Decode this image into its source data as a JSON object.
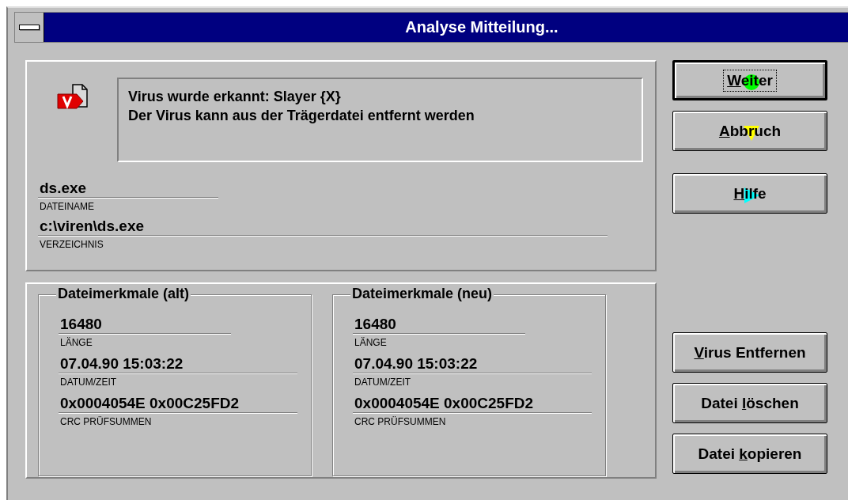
{
  "window": {
    "title": "Analyse Mitteilung..."
  },
  "message": {
    "lines": [
      "Virus wurde erkannt: Slayer {X}",
      "Der Virus kann aus der Trägerdatei entfernt werden"
    ]
  },
  "file_fields": [
    {
      "kind": "short",
      "value": "ds.exe",
      "label": "DATEINAME"
    },
    {
      "kind": "long",
      "value": "c:\\viren\\ds.exe",
      "label": "VERZEICHNIS"
    }
  ],
  "groups": [
    {
      "title": "Dateimerkmale (alt)",
      "fields": [
        {
          "kind": "short",
          "value": "16480",
          "label": "LÄNGE"
        },
        {
          "kind": "long",
          "value": "07.04.90 15:03:22",
          "label": "DATUM/ZEIT"
        },
        {
          "kind": "long",
          "value": "0x0004054E 0x00C25FD2",
          "label": "CRC PRÜFSUMMEN"
        }
      ]
    },
    {
      "title": "Dateimerkmale (neu)",
      "fields": [
        {
          "kind": "short",
          "value": "16480",
          "label": "LÄNGE"
        },
        {
          "kind": "long",
          "value": "07.04.90 15:03:22",
          "label": "DATUM/ZEIT"
        },
        {
          "kind": "long",
          "value": "0x0004054E 0x00C25FD2",
          "label": "CRC PRÜFSUMMEN"
        }
      ]
    }
  ],
  "buttons_top": [
    {
      "mnemonic": "W",
      "after": "eiter",
      "default": true,
      "focused": true,
      "kind": "circle",
      "color": "#00ff00"
    },
    {
      "mnemonic": "A",
      "after": "bbruch",
      "default": false,
      "focused": false,
      "kind": "triangle-down",
      "color": "#ffff00"
    },
    {
      "mnemonic": "H",
      "after": "ilfe",
      "default": false,
      "focused": false,
      "kind": "triangle-right",
      "color": "#00ffff"
    }
  ],
  "buttons_bottom": [
    {
      "mnemonic": "V",
      "after": "irus Entfernen",
      "default": false,
      "focused": false
    },
    {
      "before": "Datei ",
      "mnemonic": "l",
      "after": "öschen",
      "default": false,
      "focused": false
    },
    {
      "before": "Datei ",
      "mnemonic": "k",
      "after": "opieren",
      "default": false,
      "focused": false
    }
  ]
}
